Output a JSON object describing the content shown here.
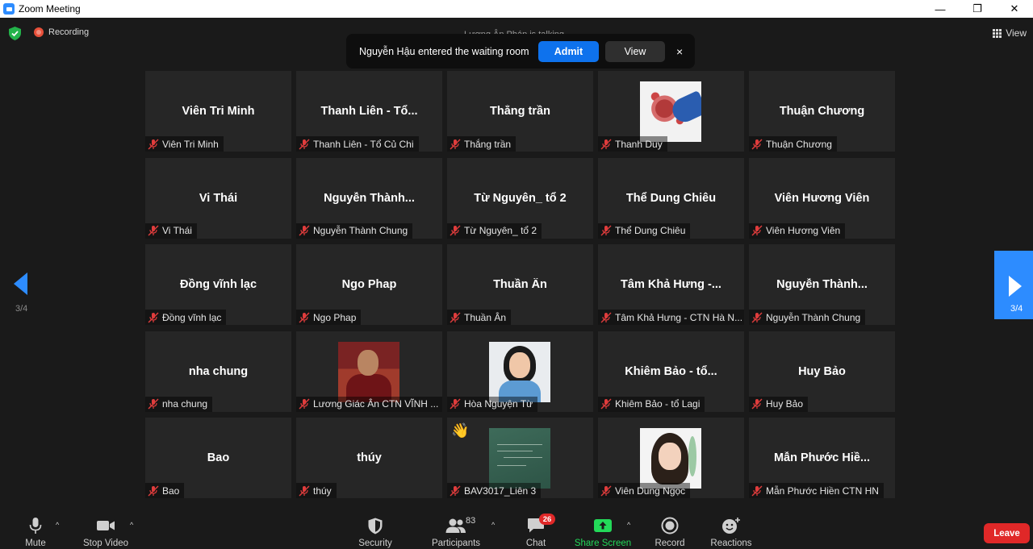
{
  "window": {
    "title": "Zoom Meeting",
    "controls": [
      "—",
      "❐",
      "✕"
    ]
  },
  "topbar": {
    "recording_label": "Recording",
    "view_label": "View",
    "talking_text": "Lương Ân Pháp is talking..."
  },
  "notification": {
    "message": "Nguyễn Hậu entered the waiting room",
    "admit_label": "Admit",
    "view_label": "View",
    "close_glyph": "×"
  },
  "colors": {
    "accent": "#2d8cff",
    "admit": "#0e72ed",
    "leave": "#e02828",
    "share": "#23d959",
    "muted": "#e03c3c"
  },
  "participants": [
    {
      "display": "Viên Tri Minh",
      "label": "Viên Tri Minh"
    },
    {
      "display": "Thanh Liên - Tổ...",
      "label": "Thanh Liên - Tổ Củ Chi"
    },
    {
      "display": "Thắng trần",
      "label": "Thắng trần"
    },
    {
      "display": "",
      "label": "Thanh Duy"
    },
    {
      "display": "Thuận Chương",
      "label": "Thuận Chương"
    },
    {
      "display": "Vi Thái",
      "label": "Vi Thái"
    },
    {
      "display": "Nguyễn  Thành...",
      "label": "Nguyễn Thành Chung"
    },
    {
      "display": "Từ Nguyên_ tổ 2",
      "label": "Từ Nguyên_ tổ 2"
    },
    {
      "display": "Thể Dung Chiêu",
      "label": "Thể Dung Chiêu"
    },
    {
      "display": "Viên Hương Viên",
      "label": "Viên Hương Viên"
    },
    {
      "display": "Đồng vĩnh lạc",
      "label": "Đồng vĩnh lạc"
    },
    {
      "display": "Ngo Phap",
      "label": "Ngo Phap"
    },
    {
      "display": "Thuần Ân",
      "label": "Thuần Ân"
    },
    {
      "display": "Tâm Khả Hưng -...",
      "label": "Tâm Khả Hưng - CTN Hà N..."
    },
    {
      "display": "Nguyễn  Thành...",
      "label": "Nguyễn Thành Chung"
    },
    {
      "display": "nha chung",
      "label": "nha chung"
    },
    {
      "display": "",
      "label": "Lương Giác Ân CTN VĨNH ..."
    },
    {
      "display": "",
      "label": "Hòa Nguyện Từ"
    },
    {
      "display": "Khiêm Bảo -  tổ...",
      "label": "Khiêm Bảo -  tổ Lagi"
    },
    {
      "display": "Huy Bảo",
      "label": "Huy Bảo"
    },
    {
      "display": "Bao",
      "label": "Bao"
    },
    {
      "display": "thúy",
      "label": "thúy"
    },
    {
      "display": "",
      "label": "BAV3017_Liên 3"
    },
    {
      "display": "",
      "label": "Viên Dung Ngọc"
    },
    {
      "display": "Mẫn  Phước Hiề...",
      "label": "Mẫn Phước Hiền CTN HN"
    }
  ],
  "pager": {
    "left": "3/4",
    "right": "3/4"
  },
  "reaction_emoji": "👋",
  "toolbar": {
    "mute": "Mute",
    "stop_video": "Stop Video",
    "security": "Security",
    "participants": "Participants",
    "participants_count": "83",
    "chat": "Chat",
    "chat_badge": "26",
    "share_screen": "Share Screen",
    "record": "Record",
    "reactions": "Reactions",
    "leave": "Leave",
    "caret": "^"
  }
}
